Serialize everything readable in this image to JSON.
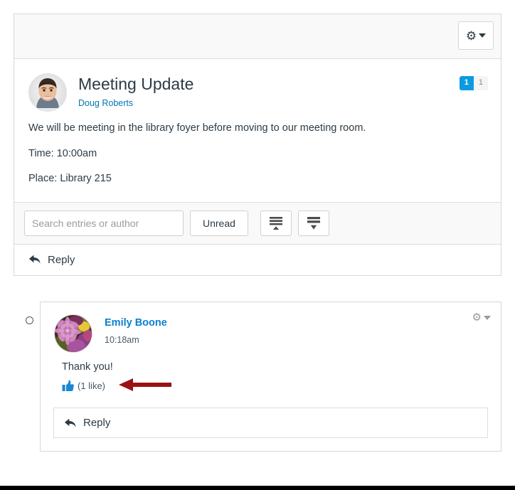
{
  "topic": {
    "toolbar": {
      "gear_menu_label": "gear-menu",
      "gear_icon": "gear-icon",
      "caret_icon": "chevron-down-icon"
    },
    "avatar_alt": "Doug Roberts avatar",
    "title": "Meeting Update",
    "author": "Doug Roberts",
    "badges": {
      "unread_count": "1",
      "total_count": "1"
    },
    "body_paragraphs": [
      "We will be meeting in the library foyer before moving to our meeting room.",
      "Time: 10:00am",
      "Place: Library 215"
    ],
    "filter_bar": {
      "search_placeholder": "Search entries or author",
      "search_value": "",
      "unread_button": "Unread",
      "collapse_icon": "collapse-threads-icon",
      "expand_icon": "expand-threads-icon"
    },
    "reply_button": "Reply",
    "reply_icon": "reply-arrow-icon"
  },
  "entry": {
    "unread_marker": "unread-dot",
    "avatar_alt": "Emily Boone avatar",
    "author": "Emily Boone",
    "timestamp": "10:18am",
    "gear_icon": "gear-icon",
    "caret_icon": "chevron-down-icon",
    "message": "Thank you!",
    "like_icon": "thumbs-up-icon",
    "like_count": "(1 like)",
    "reply_button": "Reply",
    "reply_icon": "reply-arrow-icon"
  },
  "annotation": {
    "arrow": "callout-arrow-left",
    "color": "#9b1212"
  },
  "colors": {
    "link": "#0374b5",
    "entry_link": "#0b7fcf",
    "unread_badge": "#0e9ae0",
    "like_blue": "#1a87d6",
    "panel_border": "#d8d8d8",
    "toolbar_bg": "#f9f9f9"
  }
}
